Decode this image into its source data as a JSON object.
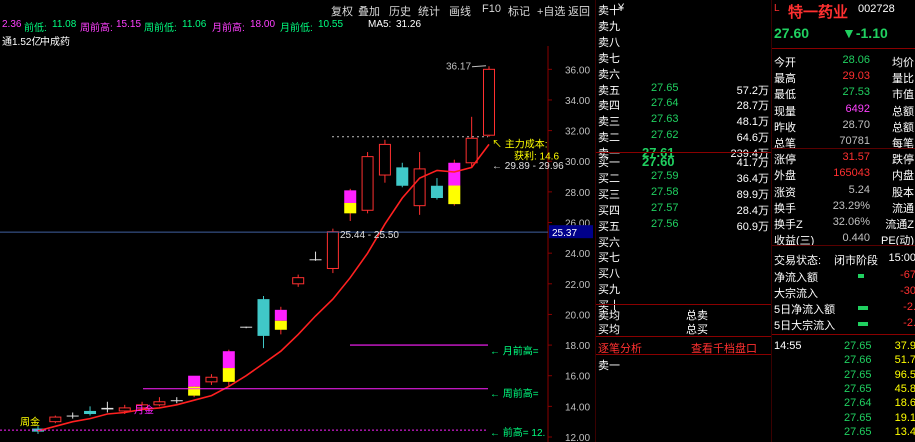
{
  "toolbar": {
    "items": [
      "复权",
      "叠加",
      "历史",
      "统计",
      "画线",
      "F10",
      "标记",
      "+自选",
      "返回"
    ]
  },
  "info": {
    "p1": "2.36",
    "prev_low_label": "前低:",
    "prev_low": "11.08",
    "week_prev_high_label": "周前高:",
    "week_prev_high": "15.15",
    "week_prev_low_label": "周前低:",
    "week_prev_low": "11.06",
    "month_prev_high_label": "月前高:",
    "month_prev_high": "18.00",
    "month_prev_low_label": "月前低:",
    "month_prev_low": "10.55",
    "ma5_label": "MA5:",
    "ma5": "31.26",
    "float_shares": "通1.52亿",
    "sector": "中成药"
  },
  "chart_data": {
    "type": "candlestick",
    "ylim": [
      12.0,
      37.0
    ],
    "y_ticks": [
      "36.00",
      "34.00",
      "32.00",
      "30.00",
      "28.00",
      "26.00",
      "24.00",
      "22.00",
      "20.00",
      "18.00",
      "16.00",
      "14.00",
      "12.00"
    ],
    "candles": [
      {
        "o": 12.55,
        "h": 12.7,
        "l": 12.2,
        "c": 12.35,
        "color": "cyan"
      },
      {
        "o": 13.0,
        "h": 13.4,
        "l": 12.9,
        "c": 13.3,
        "color": "red"
      },
      {
        "o": 13.4,
        "h": 13.6,
        "l": 13.2,
        "c": 13.4,
        "color": "white"
      },
      {
        "o": 13.5,
        "h": 14.0,
        "l": 13.4,
        "c": 13.7,
        "color": "cyan"
      },
      {
        "o": 13.8,
        "h": 14.3,
        "l": 13.6,
        "c": 13.9,
        "color": "white"
      },
      {
        "o": 13.7,
        "h": 14.1,
        "l": 13.5,
        "c": 13.9,
        "color": "red"
      },
      {
        "o": 13.9,
        "h": 14.3,
        "l": 13.8,
        "c": 14.1,
        "color": "red"
      },
      {
        "o": 14.1,
        "h": 14.6,
        "l": 14.0,
        "c": 14.3,
        "color": "red"
      },
      {
        "o": 14.4,
        "h": 14.6,
        "l": 14.2,
        "c": 14.4,
        "color": "white"
      },
      {
        "o": 14.7,
        "h": 15.8,
        "l": 14.6,
        "c": 16.0,
        "color": "magenta_yellow"
      },
      {
        "o": 15.6,
        "h": 16.1,
        "l": 15.4,
        "c": 15.9,
        "color": "red"
      },
      {
        "o": 15.6,
        "h": 17.7,
        "l": 15.3,
        "c": 17.6,
        "color": "magenta_yellow"
      },
      {
        "o": 19.2,
        "h": 19.2,
        "l": 19.1,
        "c": 19.2,
        "color": "white"
      },
      {
        "o": 21.0,
        "h": 21.2,
        "l": 17.8,
        "c": 18.6,
        "color": "cyan"
      },
      {
        "o": 19.0,
        "h": 20.5,
        "l": 18.7,
        "c": 20.3,
        "color": "magenta_yellow"
      },
      {
        "o": 22.0,
        "h": 22.6,
        "l": 21.8,
        "c": 22.4,
        "color": "red"
      },
      {
        "o": 23.6,
        "h": 24.1,
        "l": 23.5,
        "c": 23.6,
        "color": "white"
      },
      {
        "o": 23.0,
        "h": 25.6,
        "l": 22.7,
        "c": 25.4,
        "color": "red"
      },
      {
        "o": 26.6,
        "h": 28.2,
        "l": 26.1,
        "c": 28.1,
        "color": "magenta_yellow"
      },
      {
        "o": 26.8,
        "h": 30.6,
        "l": 26.6,
        "c": 30.3,
        "color": "red"
      },
      {
        "o": 29.1,
        "h": 31.4,
        "l": 28.6,
        "c": 31.1,
        "color": "red"
      },
      {
        "o": 28.4,
        "h": 29.9,
        "l": 28.3,
        "c": 29.6,
        "color": "cyan"
      },
      {
        "o": 29.5,
        "h": 30.6,
        "l": 26.5,
        "c": 27.1,
        "color": "red"
      },
      {
        "o": 28.4,
        "h": 28.9,
        "l": 27.5,
        "c": 27.6,
        "color": "cyan"
      },
      {
        "o": 27.2,
        "h": 30.1,
        "l": 27.1,
        "c": 29.9,
        "color": "magenta_yellow"
      },
      {
        "o": 29.9,
        "h": 32.9,
        "l": 29.6,
        "c": 31.5,
        "color": "red"
      },
      {
        "o": 31.7,
        "h": 36.2,
        "l": 31.6,
        "c": 36.0,
        "color": "red"
      }
    ],
    "ma5": [
      12.4,
      12.7,
      13.0,
      13.2,
      13.5,
      13.6,
      13.8,
      13.9,
      14.1,
      14.4,
      14.7,
      15.3,
      16.0,
      16.8,
      17.6,
      18.7,
      19.9,
      21.0,
      22.4,
      24.0,
      25.9,
      27.6,
      28.9,
      29.4,
      29.3,
      29.6,
      31.1
    ],
    "annotations": {
      "high_label": "36.17",
      "cost_label": "主力成本:",
      "profit_label": "获利: 14.6",
      "range_upper": "29.89 - 29.96",
      "range_lower": "25.44 - 25.50",
      "price_tag": "25.37",
      "month_prev_high": "← 月前高=",
      "week_prev_high": "← 周前高=",
      "prev_high": "← 前高= 12.",
      "week_gold": "周金",
      "month_gold": "月金"
    }
  },
  "orderbook": {
    "sells": [
      {
        "label": "卖十",
        "price": "",
        "vol": ""
      },
      {
        "label": "卖九",
        "price": "",
        "vol": ""
      },
      {
        "label": "卖八",
        "price": "",
        "vol": ""
      },
      {
        "label": "卖七",
        "price": "",
        "vol": ""
      },
      {
        "label": "卖六",
        "price": "",
        "vol": ""
      },
      {
        "label": "卖五",
        "price": "27.65",
        "vol": "57.2万"
      },
      {
        "label": "卖四",
        "price": "27.64",
        "vol": "28.7万"
      },
      {
        "label": "卖三",
        "price": "27.63",
        "vol": "48.1万"
      },
      {
        "label": "卖二",
        "price": "27.62",
        "vol": "64.6万"
      },
      {
        "label": "卖一",
        "price": "27.61",
        "vol": "239.4万"
      }
    ],
    "currency": "¥",
    "buys": [
      {
        "label": "买一",
        "price": "27.60",
        "vol": "41.7万"
      },
      {
        "label": "买二",
        "price": "27.59",
        "vol": "36.4万"
      },
      {
        "label": "买三",
        "price": "27.58",
        "vol": "89.9万"
      },
      {
        "label": "买四",
        "price": "27.57",
        "vol": "28.4万"
      },
      {
        "label": "买五",
        "price": "27.56",
        "vol": "60.9万"
      },
      {
        "label": "买六",
        "price": "",
        "vol": ""
      },
      {
        "label": "买七",
        "price": "",
        "vol": ""
      },
      {
        "label": "买八",
        "price": "",
        "vol": ""
      },
      {
        "label": "买九",
        "price": "",
        "vol": ""
      },
      {
        "label": "买十",
        "price": "",
        "vol": ""
      }
    ],
    "avg_sell_label": "卖均",
    "total_sell_label": "总卖",
    "avg_buy_label": "买均",
    "total_buy_label": "总买",
    "tick_analysis": "逐笔分析",
    "view_ten": "查看千档盘口",
    "sell_one": "卖一"
  },
  "quote": {
    "marker": "L",
    "name": "特一药业",
    "code": "002728",
    "price": "27.60",
    "change": "▼-1.10",
    "rows": [
      {
        "l1": "今开",
        "v1": "28.06",
        "c1": "green",
        "l2": "均价",
        "v2": "",
        "c2": ""
      },
      {
        "l1": "最高",
        "v1": "29.03",
        "c1": "red",
        "l2": "量比",
        "v2": "",
        "c2": ""
      },
      {
        "l1": "最低",
        "v1": "27.53",
        "c1": "green",
        "l2": "市值",
        "v2": "",
        "c2": ""
      },
      {
        "l1": "现量",
        "v1": "6492",
        "c1": "magenta",
        "l2": "总额",
        "v2": "",
        "c2": ""
      },
      {
        "l1": "昨收",
        "v1": "28.70",
        "c1": "gray",
        "l2": "总额",
        "v2": "",
        "c2": ""
      },
      {
        "l1": "总笔",
        "v1": "70781",
        "c1": "gray",
        "l2": "每笔",
        "v2": "",
        "c2": ""
      },
      {
        "l1": "涨停",
        "v1": "31.57",
        "c1": "red",
        "l2": "跌停",
        "v2": "",
        "c2": ""
      },
      {
        "l1": "外盘",
        "v1": "165043",
        "c1": "red",
        "l2": "内盘",
        "v2": "",
        "c2": ""
      },
      {
        "l1": "涨资",
        "v1": "5.24",
        "c1": "gray",
        "l2": "股本",
        "v2": "",
        "c2": ""
      },
      {
        "l1": "换手",
        "v1": "23.29%",
        "c1": "gray",
        "l2": "流通",
        "v2": "",
        "c2": ""
      },
      {
        "l1": "换手Z",
        "v1": "32.06%",
        "c1": "gray",
        "l2": "流通Z",
        "v2": "",
        "c2": ""
      },
      {
        "l1": "收益(三)",
        "v1": "0.440",
        "c1": "gray",
        "l2": "PE(动)",
        "v2": "",
        "c2": ""
      }
    ],
    "status_label": "交易状态:",
    "status_value": "闭市阶段",
    "status_time": "15:00",
    "flows": [
      {
        "label": "净流入额",
        "value": "-67",
        "bar": 0.15
      },
      {
        "label": "大宗流入",
        "value": "-30",
        "bar": 0.0
      },
      {
        "label": "5日净流入额",
        "value": "-2.",
        "bar": 0.25
      },
      {
        "label": "5日大宗流入",
        "value": "-2.",
        "bar": 0.25
      }
    ],
    "ticks_time": "14:55",
    "ticks": [
      {
        "price": "27.65",
        "vol": "37.9"
      },
      {
        "price": "27.66",
        "vol": "51.7"
      },
      {
        "price": "27.65",
        "vol": "96.5"
      },
      {
        "price": "27.65",
        "vol": "45.8"
      },
      {
        "price": "27.64",
        "vol": "18.6"
      },
      {
        "price": "27.65",
        "vol": "19.1"
      },
      {
        "price": "27.65",
        "vol": "13.4"
      }
    ]
  }
}
